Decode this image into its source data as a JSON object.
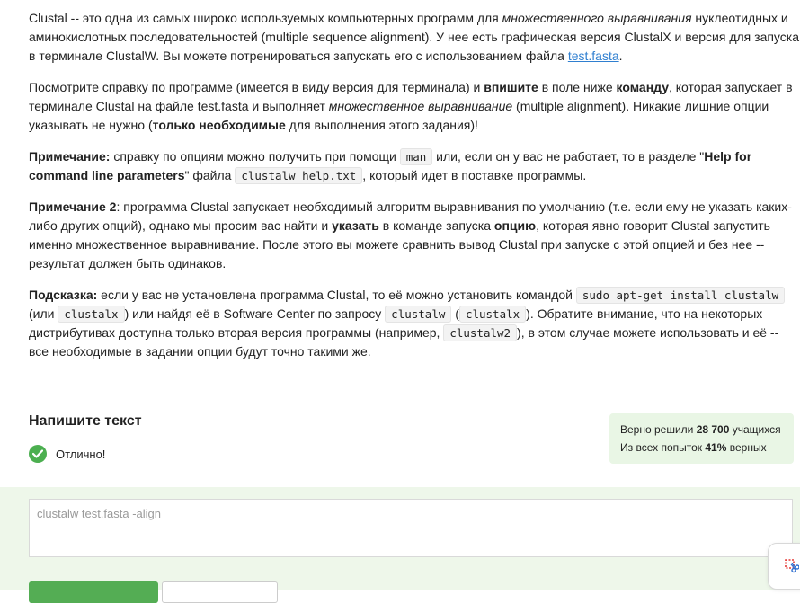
{
  "instructions": {
    "p1": {
      "t1": "Clustal -- это одна из самых широко используемых компьютерных программ для ",
      "i1": "множественного выравнивания",
      "t2": " нуклеотидных и аминокислотных последовательностей (multiple sequence alignment). У нее есть графическая версия ClustalX и версия для запуска в терминале ClustalW. Вы можете потренироваться запускать его с использованием файла ",
      "link": "test.fasta",
      "t3": "."
    },
    "p2": {
      "t1": "Посмотрите справку по программе (имеется в виду версия для терминала) и ",
      "b1": "впишите",
      "t2": " в поле ниже ",
      "b2": "команду",
      "t3": ", которая запускает в терминале Clustal на файле test.fasta и выполняет ",
      "i1": "множественное выравнивание",
      "t4": " (multiple alignment). Никакие лишние опции указывать не нужно (",
      "b3": "только необходимые",
      "t5": " для выполнения этого задания)!"
    },
    "p3": {
      "b1": "Примечание:",
      "t1": " справку по опциям можно получить при помощи ",
      "c1": "man",
      "t2": " или, если он у вас не работает, то в разделе \"",
      "b2": "Help for command line parameters",
      "t3": "\" файла ",
      "c2": "clustalw_help.txt",
      "t4": ", который идет в поставке программы."
    },
    "p4": {
      "b1": "Примечание 2",
      "t1": ": программа Clustal запускает необходимый алгоритм выравнивания по умолчанию (т.е. если ему не указать каких-либо других опций), однако мы просим вас найти и ",
      "b2": "указать",
      "t2": " в команде запуска ",
      "b3": "опцию",
      "t3": ", которая явно говорит Clustal запустить именно множественное выравнивание. После этого вы можете сравнить вывод Clustal при запуске с этой опцией и без нее -- результат должен быть одинаков."
    },
    "p5": {
      "b1": "Подсказка:",
      "t1": " если у вас не установлена программа Clustal, то её можно установить командой ",
      "c1": "sudo apt-get install clustalw",
      "t2": " (или ",
      "c2": "clustalx",
      "t3": ") или найдя её в Software Center по запросу ",
      "c3": "clustalw",
      "t4": " (",
      "c4": "clustalx",
      "t5": "). Обратите внимание, что на некоторых дистрибутивах доступна только вторая версия программы (например, ",
      "c5": "clustalw2",
      "t6": "), в этом случае можете использовать и её -- все необходимые в задании опции будут точно такими же."
    }
  },
  "task": {
    "title": "Напишите текст",
    "status": "Отлично!",
    "status_icon": "check-circle-icon"
  },
  "stats": {
    "line1_pre": "Верно решили ",
    "line1_count": "28 700",
    "line1_post": " учащихся",
    "line2_pre": "Из всех попыток ",
    "line2_percent": "41%",
    "line2_post": " верных"
  },
  "answer": {
    "value": "clustalw test.fasta -align"
  },
  "colors": {
    "accent_green": "#54ad54",
    "success_bg": "#eef7ea",
    "stats_bg": "#e9f6e5",
    "link": "#2f7fd0"
  },
  "widget": {
    "icon": "scissors-icon"
  }
}
